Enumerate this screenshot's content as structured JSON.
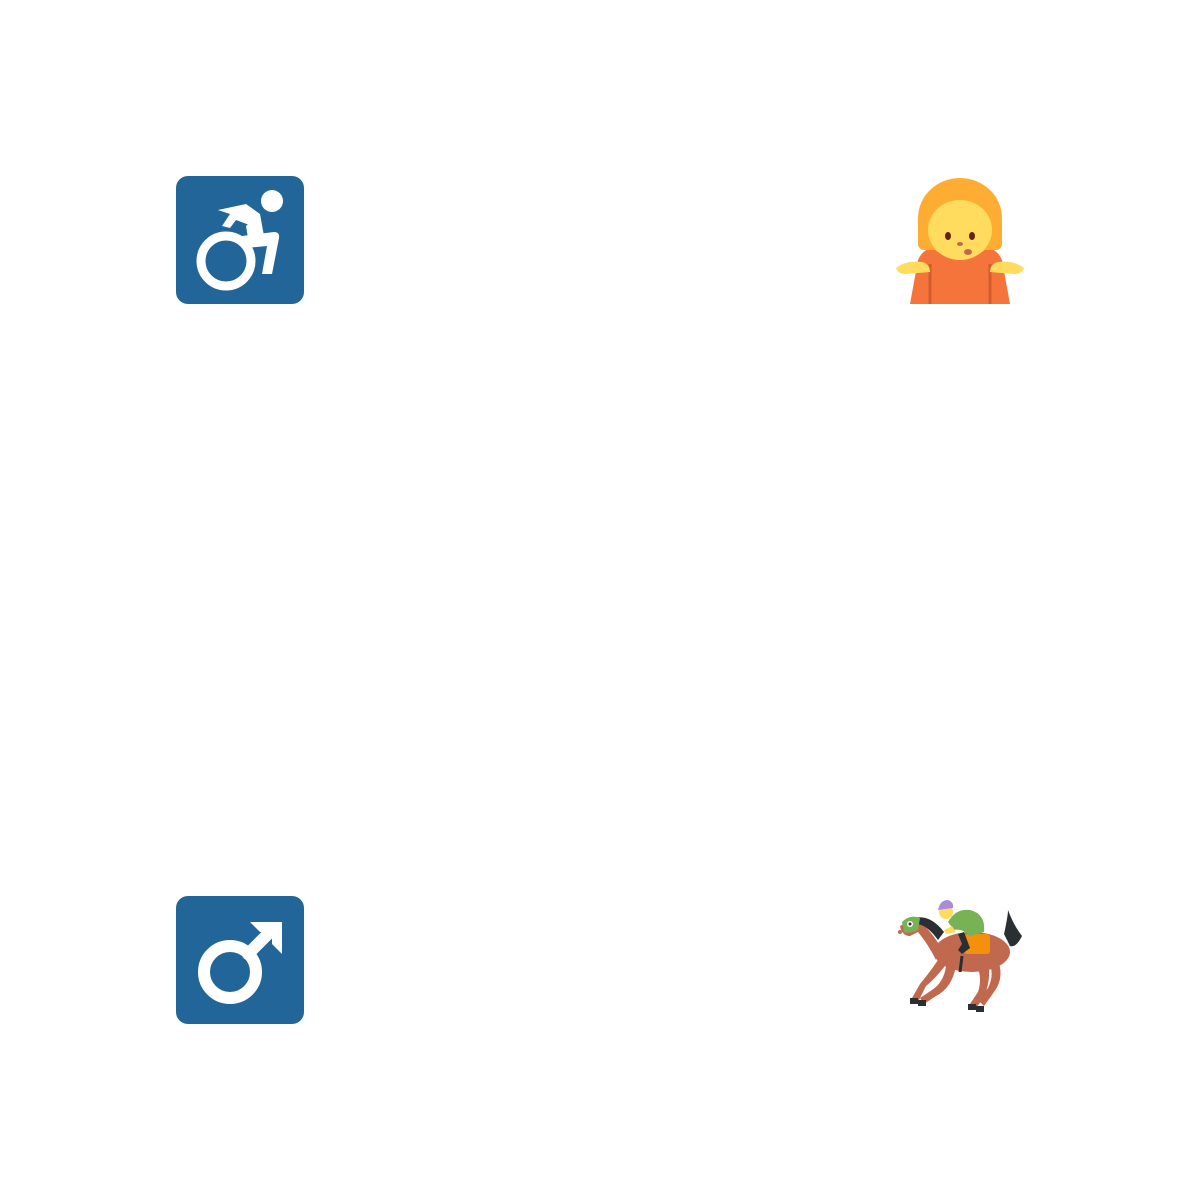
{
  "canvas": {
    "background": "#ffffff"
  },
  "emojis": [
    {
      "id": "motorized-wheelchair",
      "icon": "wheelchair-symbol-icon",
      "colors": {
        "tile": "#226699",
        "glyph": "#ffffff"
      }
    },
    {
      "id": "person-shrugging",
      "icon": "person-shrugging-icon",
      "colors": {
        "hair": "#FFAC33",
        "skin": "#FFDC5D",
        "shirt": "#F4743B",
        "mouth": "#C1694F"
      }
    },
    {
      "id": "male-sign",
      "icon": "male-sign-icon",
      "colors": {
        "tile": "#226699",
        "glyph": "#ffffff"
      }
    },
    {
      "id": "horse-racing",
      "icon": "horse-racing-icon",
      "colors": {
        "horse": "#C1694F",
        "mane": "#292F33",
        "jockey_shirt": "#77B255",
        "cap": "#AA8DD8",
        "saddle": "#F4900C"
      }
    }
  ]
}
